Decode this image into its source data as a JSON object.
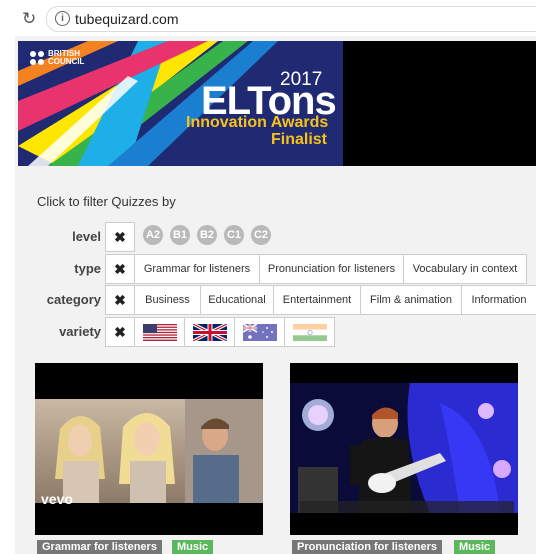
{
  "browser": {
    "url": "tubequizard.com",
    "reload_icon": "reload-icon",
    "info_icon": "info-icon"
  },
  "banner": {
    "brand_line1": "BRITISH",
    "brand_line2": "COUNCIL",
    "year": "2017",
    "title": "ELTons",
    "subtitle": "Innovation Awards",
    "finalist": "Finalist",
    "colors": {
      "navy": "#1f2a73",
      "gold": "#f7c21a",
      "pink": "#e8336d",
      "blue": "#1eaee8",
      "yellow": "#ffe600",
      "green": "#38b24a"
    }
  },
  "filters": {
    "title": "Click to filter Quizzes by",
    "clear_symbol": "✖",
    "level": {
      "label": "level",
      "options": [
        "A2",
        "B1",
        "B2",
        "C1",
        "C2"
      ]
    },
    "type": {
      "label": "type",
      "options": [
        "Grammar for listeners",
        "Pronunciation for listeners",
        "Vocabulary in context"
      ]
    },
    "category": {
      "label": "category",
      "options": [
        "Business",
        "Educational",
        "Entertainment",
        "Film & animation",
        "Information"
      ]
    },
    "variety": {
      "label": "variety",
      "options": [
        "us-flag",
        "uk-flag",
        "australia-flag",
        "india-flag"
      ]
    }
  },
  "videos": [
    {
      "watermark": "vevo",
      "type_tag": "Grammar for listeners",
      "category_tag": "Music"
    },
    {
      "watermark": "",
      "type_tag": "Pronunciation for listeners",
      "category_tag": "Music"
    }
  ],
  "tag_colors": {
    "type": "#777777",
    "category": "#5cb85c"
  }
}
